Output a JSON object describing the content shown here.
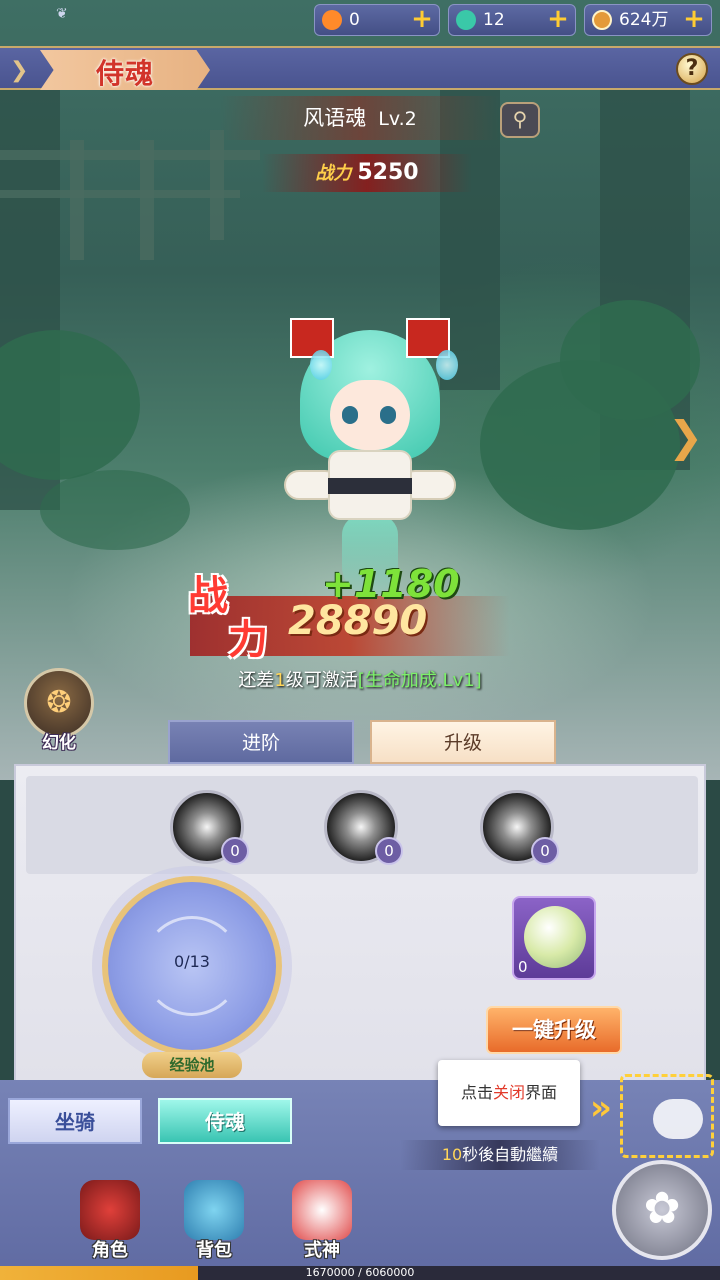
{
  "resources": [
    {
      "icon": "gem-icon",
      "value": "0",
      "color": "#ff8a2a"
    },
    {
      "icon": "jade-icon",
      "value": "12",
      "color": "#3ac8a8"
    },
    {
      "icon": "coin-icon",
      "value": "624万",
      "color": "#e49a3a"
    }
  ],
  "header": {
    "title": "侍魂"
  },
  "soul": {
    "name": "风语魂",
    "level": "Lv.2",
    "power_label": "战力",
    "power": "5250"
  },
  "combat": {
    "label_1": "战",
    "label_2": "力",
    "value": "28890",
    "delta": "+1180"
  },
  "activation": {
    "prefix": "还差",
    "level_count": "1",
    "level_word": "级",
    "middle": "可激活",
    "bonus": "[生命加成.Lv1]"
  },
  "transform": {
    "label": "幻化"
  },
  "tabs": {
    "advance": "进阶",
    "upgrade": "升级"
  },
  "skills": [
    {
      "count": "0"
    },
    {
      "count": "0"
    },
    {
      "count": "0"
    }
  ],
  "exp_pool": {
    "progress": "0/13",
    "label": "经验池"
  },
  "item": {
    "count": "0"
  },
  "buttons": {
    "one_key_upgrade": "一键升级"
  },
  "subtabs": {
    "mount": "坐骑",
    "soul": "侍魂"
  },
  "tutorial": {
    "hint_prefix": "点击",
    "hint_highlight": "关闭",
    "hint_suffix": "界面",
    "auto_seconds": "10",
    "auto_text": "秒後自動繼續"
  },
  "nav": [
    {
      "label": "角色"
    },
    {
      "label": "背包"
    },
    {
      "label": "式神"
    }
  ],
  "exp": {
    "text": "1670000 / 6060000",
    "fraction": 0.2756
  }
}
